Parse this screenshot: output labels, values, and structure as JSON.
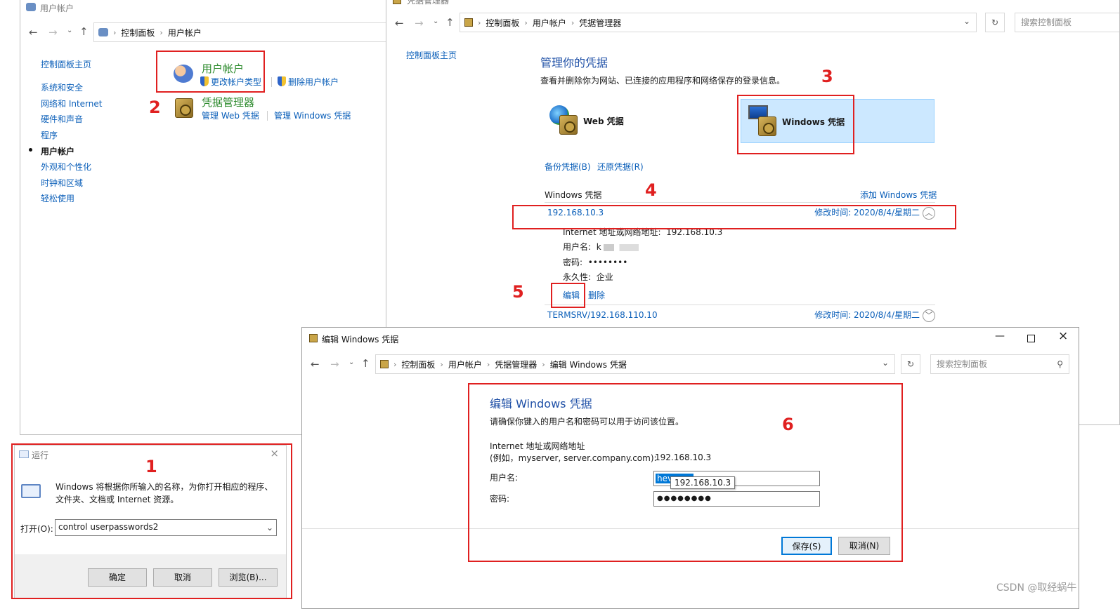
{
  "user_accounts_window": {
    "title": "用户帐户",
    "breadcrumb": [
      "控制面板",
      "用户帐户"
    ],
    "sidebar": {
      "home": "控制面板主页",
      "items": [
        "系统和安全",
        "网络和 Internet",
        "硬件和声音",
        "程序",
        "用户帐户",
        "外观和个性化",
        "时钟和区域",
        "轻松使用"
      ]
    },
    "section_user_accounts": {
      "title": "用户帐户",
      "link_change_type": "更改帐户类型",
      "link_delete": "删除用户帐户"
    },
    "section_credentials": {
      "title": "凭据管理器",
      "link_web": "管理 Web 凭据",
      "link_windows": "管理 Windows 凭据"
    }
  },
  "credential_manager_window": {
    "title": "凭据管理器",
    "breadcrumb": [
      "控制面板",
      "用户帐户",
      "凭据管理器"
    ],
    "search_placeholder": "搜索控制面板",
    "sidebar_home": "控制面板主页",
    "heading": "管理你的凭据",
    "description": "查看并删除你为网站、已连接的应用程序和网络保存的登录信息。",
    "tab_web": "Web 凭据",
    "tab_windows": "Windows 凭据",
    "link_backup": "备份凭据(B)",
    "link_restore": "还原凭据(R)",
    "section_label": "Windows 凭据",
    "add_link": "添加 Windows 凭据",
    "entries": [
      {
        "name": "192.168.10.3",
        "modified": "修改时间:  2020/8/4/星期二"
      },
      {
        "name": "TERMSRV/192.168.110.10",
        "modified": "修改时间:  2020/8/4/星期二"
      }
    ],
    "details": {
      "address_label": "Internet 地址或网络地址:",
      "address_value": "192.168.10.3",
      "user_label": "用户名:",
      "user_value": "k",
      "password_label": "密码:",
      "password_value": "••••••••",
      "persistence_label": "永久性:",
      "persistence_value": "企业",
      "edit_link": "编辑",
      "delete_link": "删除"
    }
  },
  "run_dialog": {
    "title": "运行",
    "description_line1": "Windows 将根据你所输入的名称，为你打开相应的程序、",
    "description_line2": "文件夹、文档或 Internet 资源。",
    "open_label": "打开(O):",
    "open_value": "control userpasswords2",
    "ok": "确定",
    "cancel": "取消",
    "browse": "浏览(B)..."
  },
  "edit_dialog": {
    "title": "编辑 Windows 凭据",
    "breadcrumb": [
      "控制面板",
      "用户帐户",
      "凭据管理器",
      "编辑 Windows 凭据"
    ],
    "search_placeholder": "搜索控制面板",
    "heading": "编辑 Windows 凭据",
    "instruction": "请确保你键入的用户名和密码可以用于访问该位置。",
    "address_label_1": "Internet 地址或网络地址",
    "address_label_2": "(例如，myserver, server.company.com):",
    "address_value": "192.168.10.3",
    "user_label": "用户名:",
    "user_value": "hev",
    "tooltip": "192.168.10.3",
    "password_label": "密码:",
    "password_value": "●●●●●●●●",
    "save": "保存(S)",
    "cancel": "取消(N)"
  },
  "annotations": [
    "1",
    "2",
    "3",
    "4",
    "5",
    "6"
  ],
  "watermark": "CSDN @取经蜗牛",
  "colors": {
    "red": "#e02020",
    "link": "#0b5fb9",
    "green": "#2c8a2c",
    "selected_bg": "#cce8ff"
  }
}
